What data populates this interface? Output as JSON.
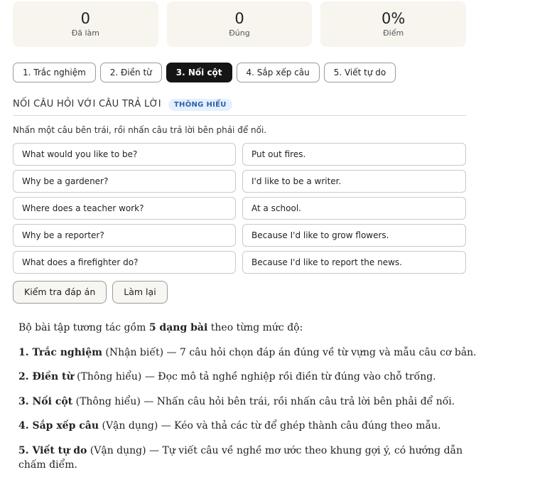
{
  "stats": [
    {
      "value": "0",
      "label": "Đã làm"
    },
    {
      "value": "0",
      "label": "Đúng"
    },
    {
      "value": "0%",
      "label": "Điểm"
    }
  ],
  "tabs": [
    {
      "label": "1. Trắc nghiệm",
      "active": false
    },
    {
      "label": "2. Điền từ",
      "active": false
    },
    {
      "label": "3. Nối cột",
      "active": true
    },
    {
      "label": "4. Sắp xếp câu",
      "active": false
    },
    {
      "label": "5. Viết tự do",
      "active": false
    }
  ],
  "section": {
    "title": "NỐI CÂU HỎI VỚI CÂU TRẢ LỜI",
    "badge": "THÔNG HIỂU",
    "instruction": "Nhấn một câu bên trái, rồi nhấn câu trả lời bên phải để nối."
  },
  "questions": [
    "What would you like to be?",
    "Why be a gardener?",
    "Where does a teacher work?",
    "Why be a reporter?",
    "What does a firefighter do?"
  ],
  "answers": [
    "Put out fires.",
    "I'd like to be a writer.",
    "At a school.",
    "Because I'd like to grow flowers.",
    "Because I'd like to report the news."
  ],
  "actions": {
    "check_label": "Kiểm tra đáp án",
    "reset_label": "Làm lại"
  },
  "description": {
    "intro_pre": "Bộ bài tập tương tác gồm ",
    "intro_bold": "5 dạng bài",
    "intro_post": " theo từng mức độ:",
    "items": [
      {
        "name": "1. Trắc nghiệm",
        "rest": " (Nhận biết) — 7 câu hỏi chọn đáp án đúng về từ vựng và mẫu câu cơ bản."
      },
      {
        "name": "2. Điền từ",
        "rest": " (Thông hiểu) — Đọc mô tả nghề nghiệp rồi điền từ đúng vào chỗ trống."
      },
      {
        "name": "3. Nối cột",
        "rest": " (Thông hiểu) — Nhấn câu hỏi bên trái, rồi nhấn câu trả lời bên phải để nối."
      },
      {
        "name": "4. Sắp xếp câu",
        "rest": " (Vận dụng) — Kéo và thả các từ để ghép thành câu đúng theo mẫu."
      },
      {
        "name": "5. Viết tự do",
        "rest": " (Vận dụng) — Tự viết câu về nghề mơ ước theo khung gợi ý, có hướng dẫn chấm điểm."
      }
    ]
  }
}
